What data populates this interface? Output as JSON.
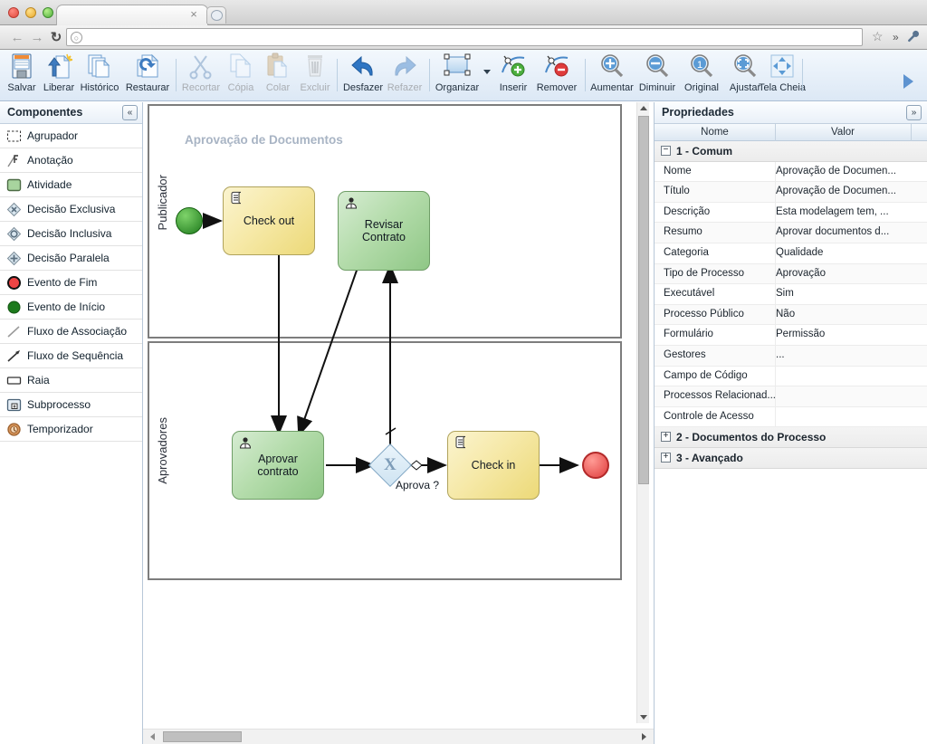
{
  "browser": {
    "tab_close": "×",
    "nav": {
      "back": "←",
      "forward": "→",
      "reload": "↻"
    },
    "url_value": "",
    "url_placeholder": "",
    "star_icon": "☆",
    "overflow_icon": "»",
    "wrench_icon": "🔧"
  },
  "toolbar": {
    "buttons": [
      {
        "label": "Salvar",
        "icon": "save-icon",
        "enabled": true
      },
      {
        "label": "Liberar",
        "icon": "publish-icon",
        "enabled": true
      },
      {
        "label": "Histórico",
        "icon": "history-icon",
        "enabled": true
      },
      {
        "label": "Restaurar",
        "icon": "restore-icon",
        "enabled": true
      },
      {
        "label": "Recortar",
        "icon": "cut-icon",
        "enabled": false
      },
      {
        "label": "Cópia",
        "icon": "copy-icon",
        "enabled": false
      },
      {
        "label": "Colar",
        "icon": "paste-icon",
        "enabled": false
      },
      {
        "label": "Excluir",
        "icon": "delete-icon",
        "enabled": false
      },
      {
        "label": "Desfazer",
        "icon": "undo-icon",
        "enabled": true
      },
      {
        "label": "Refazer",
        "icon": "redo-icon",
        "enabled": false
      },
      {
        "label": "Organizar",
        "icon": "arrange-icon",
        "enabled": true
      },
      {
        "label": "Inserir",
        "icon": "insert-point-icon",
        "enabled": true
      },
      {
        "label": "Remover",
        "icon": "remove-point-icon",
        "enabled": true
      },
      {
        "label": "Aumentar",
        "icon": "zoom-in-icon",
        "enabled": true
      },
      {
        "label": "Diminuir",
        "icon": "zoom-out-icon",
        "enabled": true
      },
      {
        "label": "Original",
        "icon": "zoom-original-icon",
        "enabled": true
      },
      {
        "label": "Ajustar",
        "icon": "zoom-fit-icon",
        "enabled": true
      },
      {
        "label": "Tela Cheia",
        "icon": "fullscreen-icon",
        "enabled": true
      }
    ],
    "overflow_arrow": "▶"
  },
  "palette": {
    "title": "Componentes",
    "collapse_label": "«",
    "items": [
      {
        "label": "Agrupador",
        "icon": "group-box-icon"
      },
      {
        "label": "Anotação",
        "icon": "annotation-icon"
      },
      {
        "label": "Atividade",
        "icon": "activity-icon"
      },
      {
        "label": "Decisão Exclusiva",
        "icon": "exclusive-gateway-icon"
      },
      {
        "label": "Decisão Inclusiva",
        "icon": "inclusive-gateway-icon"
      },
      {
        "label": "Decisão Paralela",
        "icon": "parallel-gateway-icon"
      },
      {
        "label": "Evento de Fim",
        "icon": "end-event-icon"
      },
      {
        "label": "Evento de Início",
        "icon": "start-event-icon"
      },
      {
        "label": "Fluxo de Associação",
        "icon": "association-flow-icon"
      },
      {
        "label": "Fluxo de Sequência",
        "icon": "sequence-flow-icon"
      },
      {
        "label": "Raia",
        "icon": "lane-icon"
      },
      {
        "label": "Subprocesso",
        "icon": "subprocess-icon"
      },
      {
        "label": "Temporizador",
        "icon": "timer-icon"
      }
    ]
  },
  "canvas": {
    "diagram_title": "Aprovação de Documentos",
    "lanes": [
      {
        "name": "Publicador"
      },
      {
        "name": "Aprovadores"
      }
    ],
    "nodes": [
      {
        "id": "start",
        "type": "start-event",
        "label": ""
      },
      {
        "id": "checkout",
        "type": "task-script",
        "label": "Check out",
        "fill": "yellow"
      },
      {
        "id": "revisar",
        "type": "task-user",
        "label": "Revisar\nContrato",
        "fill": "green"
      },
      {
        "id": "aprovar",
        "type": "task-user",
        "label": "Aprovar\ncontrato",
        "fill": "green"
      },
      {
        "id": "gateway",
        "type": "exclusive-gateway",
        "label": "Aprova ?",
        "marker": "X"
      },
      {
        "id": "checkin",
        "type": "task-script",
        "label": "Check in",
        "fill": "yellow"
      },
      {
        "id": "end",
        "type": "end-event",
        "label": ""
      }
    ],
    "colors": {
      "task_yellow": "#ecd978",
      "task_green": "#8fc786",
      "start_event": "#1e7a1c",
      "end_event": "#e03e3e",
      "gateway": "#cfe4f2",
      "title_text": "#a8b4c4"
    }
  },
  "properties": {
    "title": "Propriedades",
    "expand_label": "»",
    "columns": [
      "Nome",
      "Valor"
    ],
    "groups": [
      {
        "header": "1 - Comum",
        "toggle": "−",
        "expanded": true,
        "rows": [
          {
            "name": "Nome",
            "value": "Aprovação de Documen..."
          },
          {
            "name": "Título",
            "value": "Aprovação de Documen..."
          },
          {
            "name": "Descrição",
            "value": "Esta modelagem tem, ..."
          },
          {
            "name": "Resumo",
            "value": "Aprovar documentos d..."
          },
          {
            "name": "Categoria",
            "value": "Qualidade"
          },
          {
            "name": "Tipo de Processo",
            "value": "Aprovação"
          },
          {
            "name": "Executável",
            "value": "Sim"
          },
          {
            "name": "Processo Público",
            "value": "Não"
          },
          {
            "name": "Formulário",
            "value": "Permissão"
          },
          {
            "name": "Gestores",
            "value": "..."
          },
          {
            "name": "Campo de Código",
            "value": ""
          },
          {
            "name": "Processos Relacionad...",
            "value": ""
          },
          {
            "name": "Controle de Acesso",
            "value": ""
          }
        ]
      },
      {
        "header": "2 - Documentos do Processo",
        "toggle": "+",
        "expanded": false,
        "rows": []
      },
      {
        "header": "3 - Avançado",
        "toggle": "+",
        "expanded": false,
        "rows": []
      }
    ]
  }
}
